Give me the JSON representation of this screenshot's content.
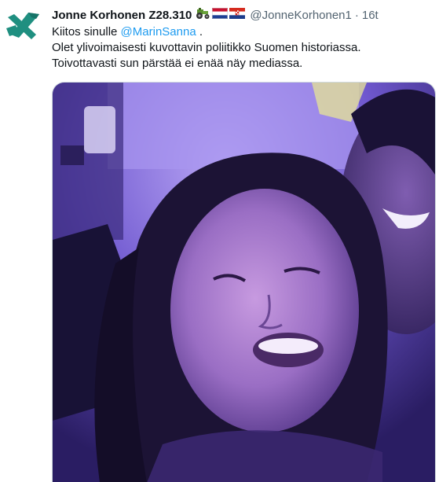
{
  "author": {
    "display_name": "Jonne Korhonen Z28.310",
    "handle": "@JonneKorhonen1",
    "separator": "·",
    "time": "16t",
    "emoji": [
      "tractor",
      "netherlands-flag",
      "croatia-flag"
    ]
  },
  "tweet": {
    "line1_prefix": "Kiitos sinulle ",
    "mention": "@MarinSanna",
    "line1_suffix": " .",
    "line2": "Olet ylivoimaisesti kuvottavin poliitikko Suomen historiassa.",
    "line3": "Toivottavasti sun pärstää ei enää näy mediassa."
  },
  "colors": {
    "accent": "#1d9bf0",
    "avatar": "#1f8f80",
    "muted": "#536471",
    "photo_tint": "#6a56c8"
  },
  "media": {
    "kind": "photo",
    "subject": "blurry selfie, purple lighting"
  }
}
